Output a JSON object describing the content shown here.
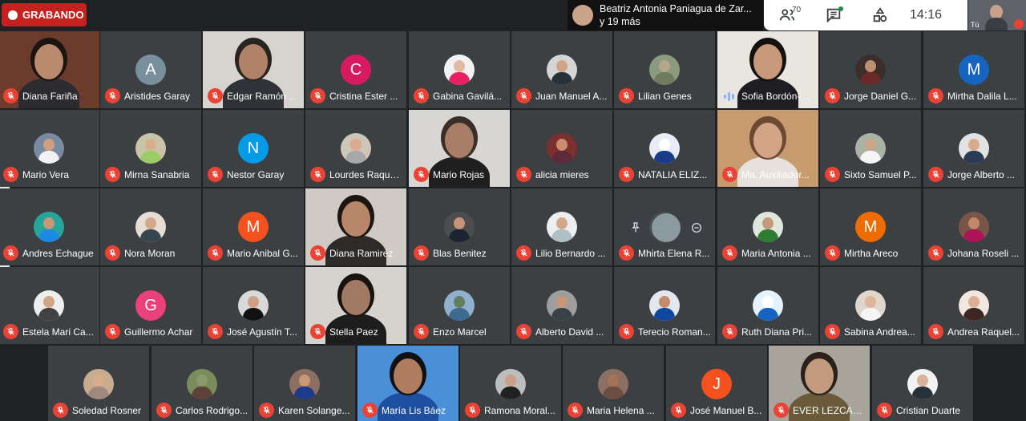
{
  "recording": {
    "label": "GRABANDO"
  },
  "presenter": {
    "name": "Beatriz Antonia Paniagua de Zar...",
    "more": "y 19 más"
  },
  "toolbar": {
    "participant_count": "70",
    "time": "14:16"
  },
  "self_view": {
    "label": "Tú"
  },
  "participants": [
    {
      "name": "Diana Fariña",
      "type": "video",
      "skin": "#b98a6e",
      "hair": "#1c1410",
      "shirt": "#2b2b30",
      "bg": "#6b3b2b"
    },
    {
      "name": "Aristides Garay",
      "type": "letter",
      "letter": "A",
      "color": "#78909c"
    },
    {
      "name": "Edgar Ramón ...",
      "type": "video",
      "skin": "#b08268",
      "hair": "#2a2420",
      "shirt": "#2f3236",
      "bg": "#d7d4cf"
    },
    {
      "name": "Cristina Ester ...",
      "type": "letter",
      "letter": "C",
      "color": "#d81b60"
    },
    {
      "name": "Gabina Gavilá...",
      "type": "photo",
      "skin": "#e0b9a0",
      "shirt": "#e91e63",
      "bg": "#f2f2f2"
    },
    {
      "name": "Juan Manuel A...",
      "type": "photo",
      "skin": "#d2a386",
      "shirt": "#263238",
      "bg": "#d5d5d5"
    },
    {
      "name": "Lilian Genes",
      "type": "photo",
      "skin": "#b4a58c",
      "shirt": "#6e7b5c",
      "bg": "#8c9a7e"
    },
    {
      "name": "Sofia Bordón- ...",
      "type": "video",
      "speaking": true,
      "skin": "#c9997c",
      "hair": "#15110e",
      "shirt": "#1d1d22",
      "bg": "#e9e5df"
    },
    {
      "name": "Jorge Daniel G...",
      "type": "photo",
      "skin": "#c08e70",
      "shirt": "#6b2a2a",
      "bg": "#3b2f2b"
    },
    {
      "name": "Mirtha Dalila L...",
      "type": "letter",
      "letter": "M",
      "color": "#1565c0"
    },
    {
      "name": "Mario Vera",
      "type": "photo",
      "skin": "#cf9f82",
      "shirt": "#f2f2f2",
      "bg": "#7a8aa0"
    },
    {
      "name": "Mirna Sanabria",
      "type": "photo",
      "skin": "#d5b190",
      "shirt": "#9ccc65",
      "bg": "#c9c3a8"
    },
    {
      "name": "Nestor Garay",
      "type": "letter",
      "letter": "N",
      "color": "#039be5"
    },
    {
      "name": "Lourdes Raque...",
      "type": "photo",
      "skin": "#d9aa8e",
      "shirt": "#a8a8a8",
      "bg": "#cfc6ba"
    },
    {
      "name": "Mario Rojas",
      "type": "video",
      "skin": "#a97e66",
      "hair": "#3a2e28",
      "shirt": "#1f1f1f",
      "bg": "#d8d6d2"
    },
    {
      "name": "alicia mieres",
      "type": "photo",
      "skin": "#c98d70",
      "shirt": "#5d2a3a",
      "bg": "#7c2f2f"
    },
    {
      "name": "NATALIA ELIZ...",
      "type": "photo",
      "skin": "#ffffff",
      "shirt": "#1a3a8a",
      "bg": "#e8ecf5"
    },
    {
      "name": "Ma. Auxiliador...",
      "type": "video",
      "skin": "#d4a487",
      "hair": "#6a4a32",
      "shirt": "#e6e1dc",
      "bg": "#c79b6e"
    },
    {
      "name": "Sixto Samuel P...",
      "type": "photo",
      "skin": "#cda486",
      "shirt": "#f5f5f5",
      "bg": "#a8b3a6"
    },
    {
      "name": "Jorge Alberto ...",
      "type": "photo",
      "skin": "#d8ab8c",
      "shirt": "#2b3a55",
      "bg": "#e2e2e2"
    },
    {
      "name": "Andres Echague",
      "type": "photo",
      "skin": "#c89778",
      "shirt": "#1e88e5",
      "bg": "#26a69a"
    },
    {
      "name": "Nora Moran",
      "type": "photo",
      "skin": "#d6a88b",
      "shirt": "#37474f",
      "bg": "#e6ddd5"
    },
    {
      "name": "Mario Anibal G...",
      "type": "letter",
      "letter": "M",
      "color": "#f4511e"
    },
    {
      "name": "Diana Ramirez",
      "type": "video",
      "skin": "#b8866a",
      "hair": "#1e1612",
      "shirt": "#2d2a2a",
      "bg": "#cfcac3"
    },
    {
      "name": "Blas Benitez",
      "type": "photo",
      "skin": "#c69478",
      "shirt": "#1c2331",
      "bg": "#4d4d4d"
    },
    {
      "name": "Lilio Bernardo ...",
      "type": "photo",
      "skin": "#d2a78a",
      "shirt": "#b0bec5",
      "bg": "#eceff1"
    },
    {
      "name": "Mhirta Elena R...",
      "type": "photo",
      "skin": "#c9a38a",
      "shirt": "#607d8b",
      "bg": "#90a4ae"
    },
    {
      "name": "Maria Antonia ...",
      "type": "photo",
      "skin": "#c49a7c",
      "shirt": "#2e7d32",
      "bg": "#dfe7dc"
    },
    {
      "name": "Mirtha Areco",
      "type": "letter",
      "letter": "M",
      "color": "#ef6c00"
    },
    {
      "name": "Johana Roseli ...",
      "type": "photo",
      "skin": "#c08a6a",
      "shirt": "#ad1457",
      "bg": "#795548"
    },
    {
      "name": "Estela Mari Ca...",
      "type": "photo",
      "skin": "#d3a68a",
      "shirt": "#424242",
      "bg": "#eeeeee"
    },
    {
      "name": "Guillermo Achar",
      "type": "letter",
      "letter": "G",
      "color": "#ec407a"
    },
    {
      "name": "José Agustín T...",
      "type": "photo",
      "skin": "#cfa083",
      "shirt": "#111111",
      "bg": "#d9d9d9"
    },
    {
      "name": "Stella Paez",
      "type": "video",
      "skin": "#a07a62",
      "hair": "#1a1411",
      "shirt": "#1d1d1d",
      "bg": "#d6d3cf"
    },
    {
      "name": "Enzo Marcel",
      "type": "photo",
      "skin": "#5f7f5f",
      "shirt": "#3d6b8f",
      "bg": "#8fb0cf"
    },
    {
      "name": "Alberto David ...",
      "type": "photo",
      "skin": "#c89777",
      "shirt": "#394247",
      "bg": "#9e9e9e"
    },
    {
      "name": "Terecio Roman...",
      "type": "photo",
      "skin": "#c18d6e",
      "shirt": "#0d47a1",
      "bg": "#e3e8ef"
    },
    {
      "name": "Ruth Diana Pri...",
      "type": "photo",
      "skin": "#ffffff",
      "shirt": "#1565c0",
      "bg": "#e3f2fd"
    },
    {
      "name": "Sabina Andrea...",
      "type": "photo",
      "skin": "#dcb59a",
      "shirt": "#f5f5f5",
      "bg": "#e0d6cc"
    },
    {
      "name": "Andrea Raquel...",
      "type": "photo",
      "skin": "#dbb096",
      "shirt": "#3e2723",
      "bg": "#f1e7df"
    },
    {
      "name": "Soledad Rosner",
      "type": "photo",
      "skin": "#d8ac8c",
      "shirt": "#a1887f",
      "bg": "#c9ab8f"
    },
    {
      "name": "Carlos Rodrigo...",
      "type": "photo",
      "skin": "#8b9a6e",
      "shirt": "#5d4037",
      "bg": "#7a8b5c"
    },
    {
      "name": "Karen Solange...",
      "type": "photo",
      "skin": "#c9977a",
      "shirt": "#1e3a8a",
      "bg": "#8d6e63"
    },
    {
      "name": "María Lis Báez",
      "type": "video",
      "skin": "#b07c60",
      "hair": "#111111",
      "shirt": "#1f4fa0",
      "bg": "#4a90d9"
    },
    {
      "name": "Ramona Moral...",
      "type": "photo",
      "skin": "#caa08a",
      "shirt": "#212121",
      "bg": "#bdbdbd"
    },
    {
      "name": "Maria Helena ...",
      "type": "photo",
      "skin": "#a57456",
      "shirt": "#6d4c41",
      "bg": "#8d6e63"
    },
    {
      "name": "José Manuel B...",
      "type": "letter",
      "letter": "J",
      "color": "#f4511e"
    },
    {
      "name": "EVER LEZCAN...",
      "type": "video",
      "skin": "#c29a7e",
      "hair": "#2a211c",
      "shirt": "#6b5a3a",
      "bg": "#a8a39b"
    },
    {
      "name": "Cristian Duarte",
      "type": "photo",
      "skin": "#d9b39a",
      "shirt": "#263238",
      "bg": "#f2f2f2"
    }
  ]
}
